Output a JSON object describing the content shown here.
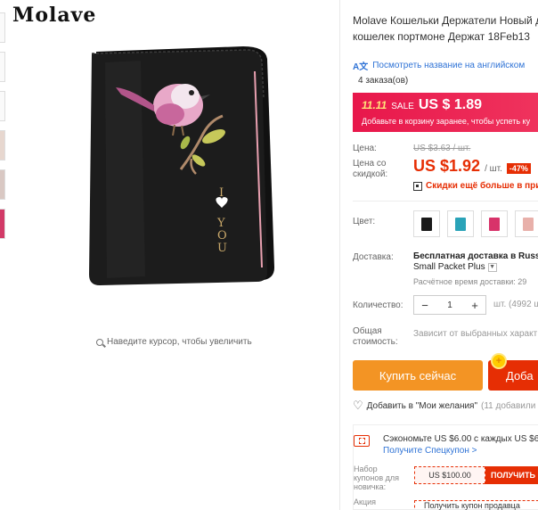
{
  "brand": {
    "logo_text": "Molave"
  },
  "gallery": {
    "zoom_hint": "Наведите курсор, чтобы увеличить",
    "thumbnails": [
      "thumb-1",
      "thumb-2",
      "thumb-3",
      "thumb-4",
      "thumb-5",
      "thumb-6"
    ]
  },
  "product": {
    "title": "Molave Кошельки Держатели Новый длинный кошелек портмоне Держат 18Feb13",
    "translate_link": "Посмотреть название на английском",
    "orders": "4 заказа(ов)",
    "wallet_text": "I YOU"
  },
  "sale": {
    "tag": "11.11",
    "label": "SALE",
    "price": "US $ 1.89",
    "note": "Добавьте в корзину заранее, чтобы успеть ку"
  },
  "pricing": {
    "price_label": "Цена:",
    "old_price": "US $3.63 / шт.",
    "discount_label": "Цена со скидкой:",
    "discount_price": "US $1.92",
    "unit": "/ шт.",
    "discount_pct": "-47%",
    "more_discounts": "Скидки ещё больше в при"
  },
  "color": {
    "label": "Цвет:",
    "swatches": [
      {
        "name": "black",
        "color": "#1a1a1a"
      },
      {
        "name": "teal",
        "color": "#2aa3b8"
      },
      {
        "name": "rose",
        "color": "#d8336a"
      },
      {
        "name": "pink",
        "color": "#e8b0aa"
      }
    ]
  },
  "shipping": {
    "label": "Доставка:",
    "title": "Бесплатная доставка в Russ",
    "method": "Small Packet Plus",
    "time": "Расчётное время доставки: 29"
  },
  "quantity": {
    "label": "Количество:",
    "minus": "−",
    "value": "1",
    "plus": "+",
    "note": "шт. (4992 ш"
  },
  "total": {
    "label": "Общая стоимость:",
    "note": "Зависит от выбранных характ"
  },
  "actions": {
    "buy_now": "Купить сейчас",
    "add_to_cart": "Доба",
    "coin_glyph": "+",
    "wishlist": "Добавить в \"Мои желания\"",
    "wishlist_count": "(11 добавили"
  },
  "coupons": {
    "save_text": "Сэкономьте US $6.00 с каждых US $65",
    "get_link": "Получите Спецкупон >",
    "newbie_label": "Набор купонов для новичка:",
    "newbie_coupon": "US $100.00",
    "newbie_button": "ПОЛУЧИТЬ",
    "action_label": "Акция",
    "action_text": "Получить купон продавца"
  }
}
